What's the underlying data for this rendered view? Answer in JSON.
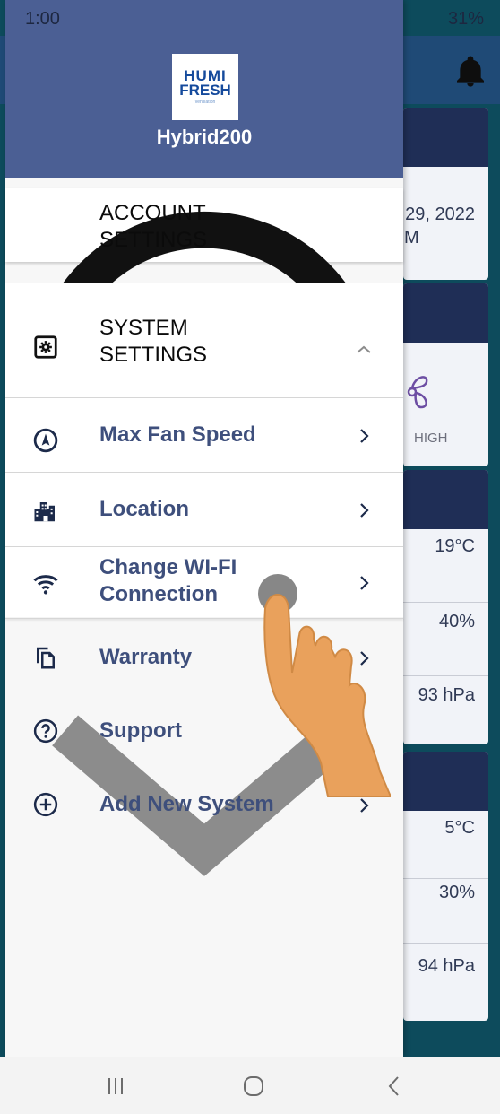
{
  "status_bar": {
    "time": "1:00",
    "right": "31%"
  },
  "drawer": {
    "system_name": "Hybrid200",
    "logo": {
      "line1": "HUMI",
      "line2": "FRESH",
      "tag": "ventilation"
    },
    "account_settings": "ACCOUNT\nSETTINGS",
    "system_settings": "SYSTEM\nSETTINGS",
    "items": [
      {
        "label": "Max Fan Speed",
        "icon": "compass-icon"
      },
      {
        "label": "Location",
        "icon": "building-icon"
      },
      {
        "label": "Change WI-FI Connection",
        "icon": "wifi-icon"
      },
      {
        "label": "Warranty",
        "icon": "copy-icon"
      },
      {
        "label": "Support",
        "icon": "help-circle-icon"
      },
      {
        "label": "Add New System",
        "icon": "plus-circle-icon"
      }
    ]
  },
  "background": {
    "date": "29, 2022",
    "date2": "M",
    "fan": "HIGH",
    "temp1": "19°C",
    "hum1": "40%",
    "press1": "93 hPa",
    "temp2": "5°C",
    "hum2": "30%",
    "press2": "94 hPa"
  }
}
